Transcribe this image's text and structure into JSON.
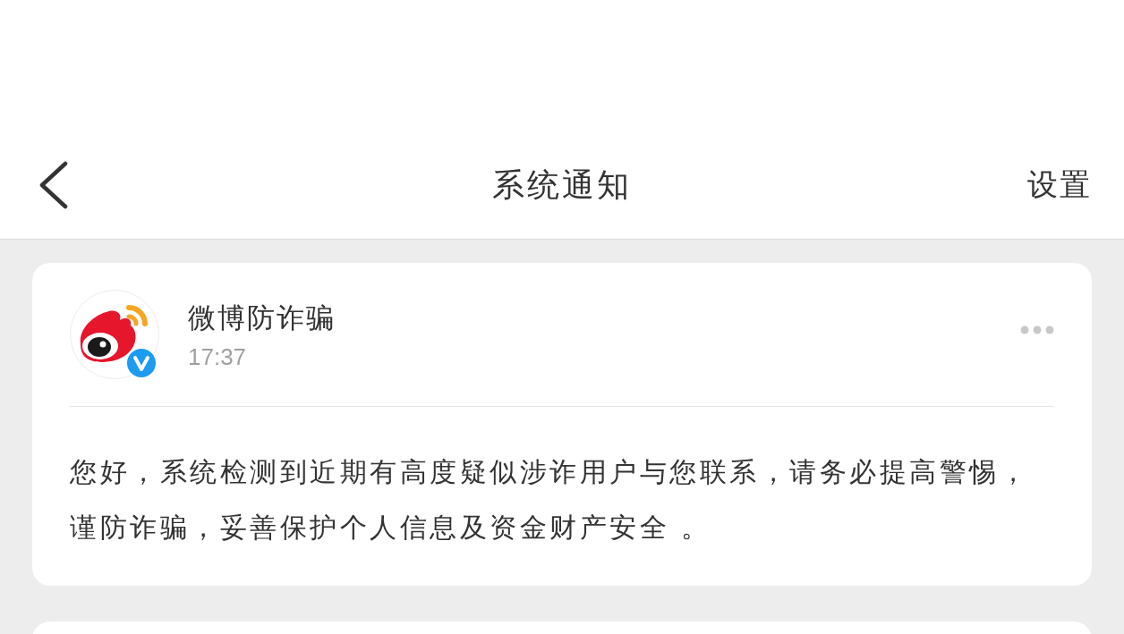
{
  "nav": {
    "title": "系统通知",
    "action": "设置"
  },
  "notifications": [
    {
      "sender": "微博防诈骗",
      "verified": true,
      "time": "17:37",
      "message": "您好，系统检测到近期有高度疑似涉诈用户与您联系，请务必提高警惕，谨防诈骗，妥善保护个人信息及资金财产安全 。"
    }
  ],
  "next_card_peek": true
}
